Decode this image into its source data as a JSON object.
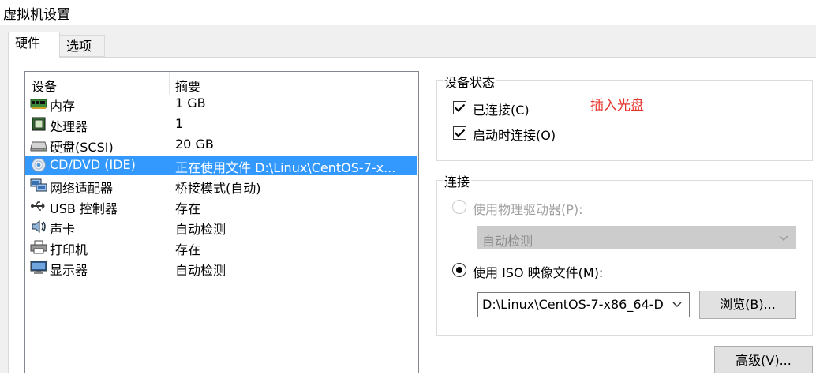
{
  "window": {
    "title": "虚拟机设置"
  },
  "tabs": [
    {
      "label": "硬件"
    },
    {
      "label": "选项"
    }
  ],
  "device_list": {
    "headers": {
      "device": "设备",
      "summary": "摘要"
    },
    "rows": [
      {
        "name": "内存",
        "summary": "1 GB",
        "icon": "memory-icon"
      },
      {
        "name": "处理器",
        "summary": "1",
        "icon": "processor-icon"
      },
      {
        "name": "硬盘(SCSI)",
        "summary": "20 GB",
        "icon": "hard-disk-icon"
      },
      {
        "name": "CD/DVD (IDE)",
        "summary": "正在使用文件 D:\\Linux\\CentOS-7-x...",
        "icon": "cd-dvd-icon"
      },
      {
        "name": "网络适配器",
        "summary": "桥接模式(自动)",
        "icon": "network-adapter-icon"
      },
      {
        "name": "USB 控制器",
        "summary": "存在",
        "icon": "usb-icon"
      },
      {
        "name": "声卡",
        "summary": "自动检测",
        "icon": "sound-card-icon"
      },
      {
        "name": "打印机",
        "summary": "存在",
        "icon": "printer-icon"
      },
      {
        "name": "显示器",
        "summary": "自动检测",
        "icon": "display-icon"
      }
    ],
    "selected_index": 3,
    "selection_color": "#3399ff"
  },
  "device_status": {
    "title": "设备状态",
    "connected_label": "已连接(C)",
    "connect_at_power_on_label": "启动时连接(O)",
    "annotation": "插入光盘",
    "annotation_color": "#e8332b"
  },
  "connection": {
    "title": "连接",
    "physical_drive_label": "使用物理驱动器(P):",
    "physical_drive_value": "自动检测",
    "iso_label": "使用 ISO 映像文件(M):",
    "iso_path": "D:\\Linux\\CentOS-7-x86_64-D",
    "browse_label": "浏览(B)..."
  },
  "advanced_label": "高级(V)..."
}
